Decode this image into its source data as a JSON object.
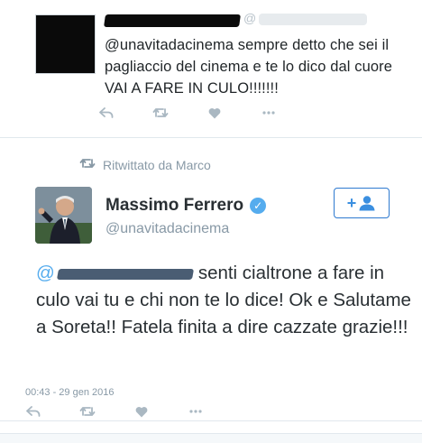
{
  "tweet1": {
    "handle_prefix": "@",
    "text": "@unavitadacinema sempre detto che sei il pagliaccio del cinema e te lo dico dal cuore VAI A FARE IN CULO!!!!!!!",
    "actions": [
      "reply-icon",
      "retweet-icon",
      "like-icon",
      "more-icon"
    ]
  },
  "retweet_notice": {
    "label": "Ritwittato da Marco"
  },
  "tweet2": {
    "name": "Massimo Ferrero",
    "handle": "@unavitadacinema",
    "follow_label": "+",
    "mention_prefix": "@",
    "text": "senti cialtrone a fare in culo vai tu e chi non te lo dice! Ok e Salutame a Soreta!! Fatela finita a dire cazzate grazie!!!",
    "timestamp": "00:43 - 29 gen 2016",
    "actions": [
      "reply-icon",
      "retweet-icon",
      "like-icon",
      "more-icon"
    ]
  },
  "colors": {
    "accent": "#55acee",
    "muted": "#8899a6",
    "icon": "#aab8c2"
  }
}
